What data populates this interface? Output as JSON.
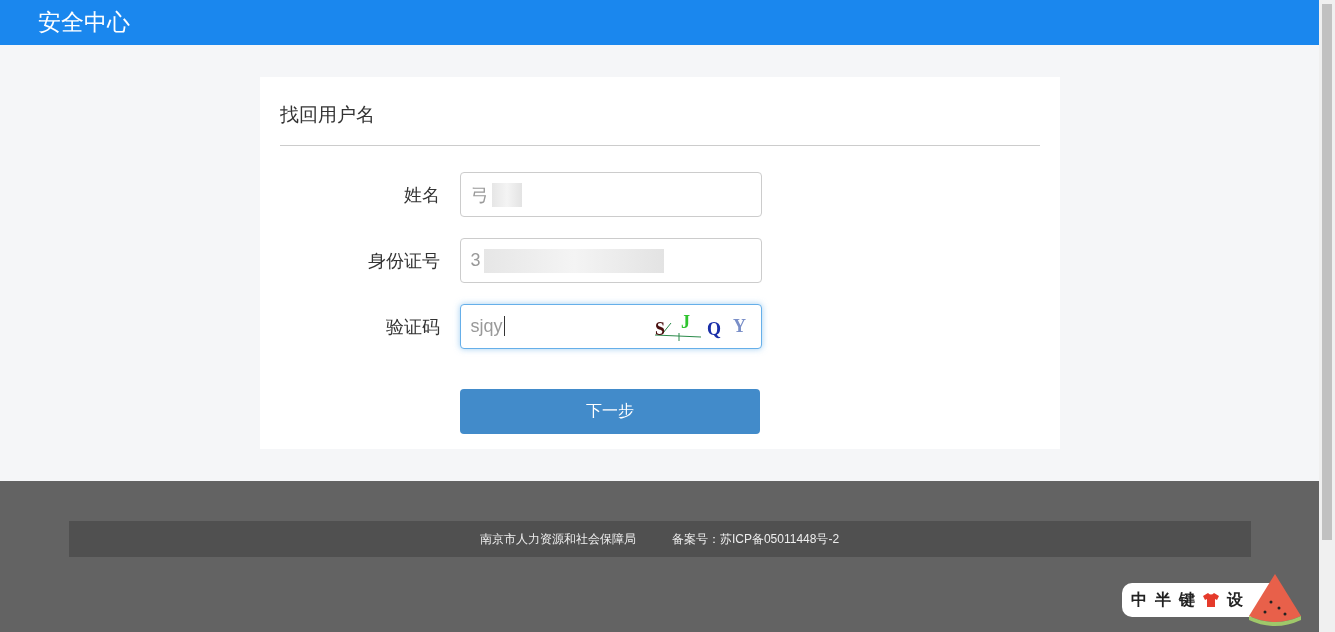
{
  "header": {
    "title": "安全中心"
  },
  "form": {
    "title": "找回用户名",
    "fields": [
      {
        "kind": "text",
        "label": "姓名",
        "value": "弓",
        "redacted": true,
        "focused": false
      },
      {
        "kind": "text",
        "label": "身份证号",
        "value": "3",
        "redacted": true,
        "focused": false
      },
      {
        "kind": "captcha",
        "label": "验证码",
        "value": "sjqy",
        "focused": true,
        "captcha": [
          {
            "char": "S",
            "color": "#4a1010"
          },
          {
            "char": "J",
            "color": "#2fc42f"
          },
          {
            "char": "Q",
            "color": "#1a2fa8"
          },
          {
            "char": "Y",
            "color": "#7a8fc8"
          }
        ]
      }
    ],
    "submit": "下一步"
  },
  "footer": {
    "items": [
      "南京市人力资源和社会保障局",
      "备案号：苏ICP备05011448号-2"
    ]
  },
  "ime_bar": {
    "items": [
      {
        "kind": "text",
        "label": "中"
      },
      {
        "kind": "text",
        "label": "半"
      },
      {
        "kind": "text",
        "label": "键"
      },
      {
        "kind": "icon"
      },
      {
        "kind": "text",
        "label": "设"
      }
    ]
  }
}
